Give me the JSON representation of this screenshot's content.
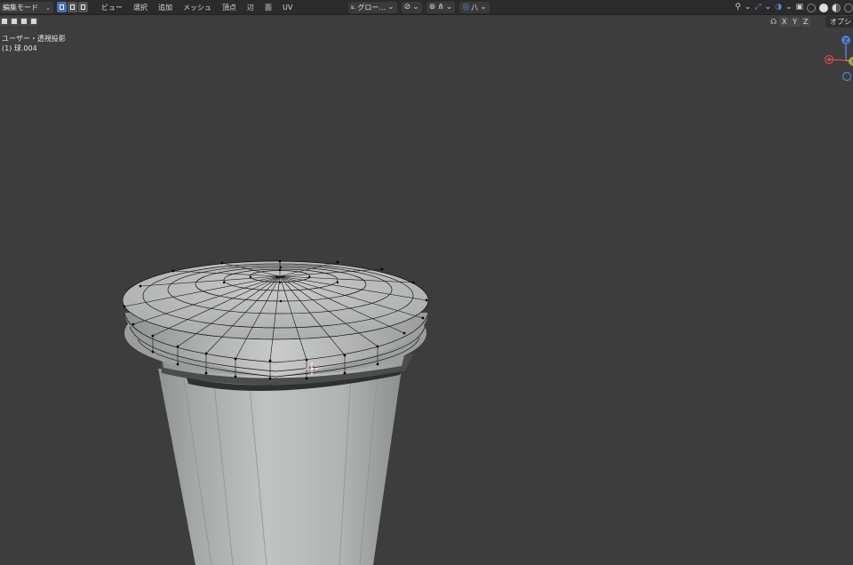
{
  "header": {
    "mode": "編集モード",
    "menu": [
      "ビュー",
      "選択",
      "追加",
      "メッシュ",
      "頂点",
      "辺",
      "面",
      "UV"
    ],
    "transform_orientation": "グロー...",
    "proportional_label": "八"
  },
  "axis_toggles": {
    "label": "☊",
    "x": "X",
    "y": "Y",
    "z": "Z"
  },
  "options_label": "オプシ",
  "viewport": {
    "view_name": "ユーザー・透視投影",
    "object_name": "(1) 球.004"
  },
  "gizmo": {
    "z": "Z",
    "x": "X",
    "y": "Y"
  },
  "colors": {
    "background": "#3d3d3d",
    "header": "#2b2b2b",
    "accent": "#4772b3",
    "mesh": "#b7b9b8"
  },
  "icons": {
    "selection_modes": [
      "vertex-select-icon",
      "edge-select-icon",
      "face-select-icon"
    ],
    "center": [
      "transform-orientation-icon",
      "pivot-icon",
      "snap-icon",
      "proportional-edit-icon"
    ],
    "right": [
      "visibility-icon",
      "gizmo-icon",
      "overlay-icon",
      "xray-icon",
      "wireframe-shading-icon",
      "solid-shading-icon",
      "material-shading-icon",
      "rendered-shading-icon"
    ]
  }
}
